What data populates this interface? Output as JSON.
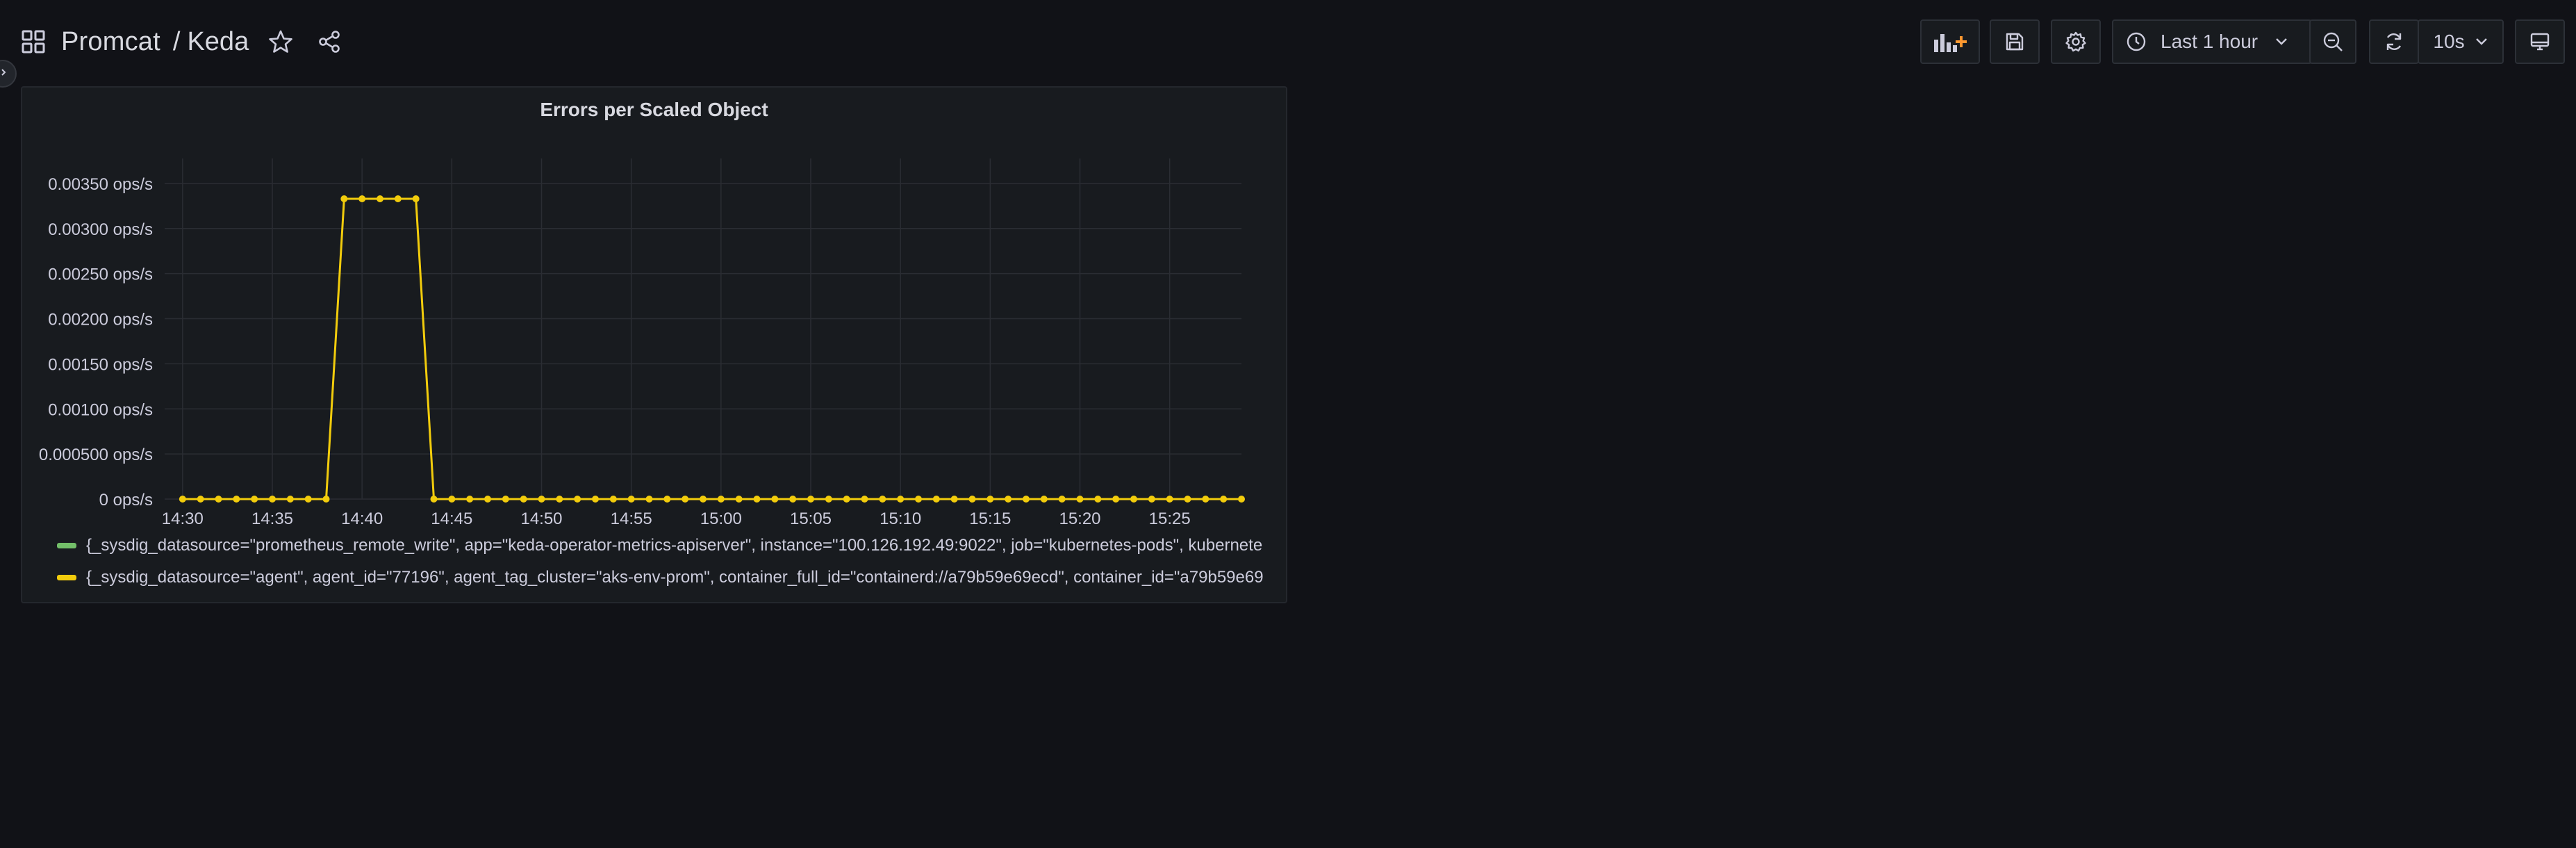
{
  "nav": {
    "parent": "Promcat",
    "separator": "/",
    "current": "Keda"
  },
  "toolbar": {
    "time_range": "Last 1 hour",
    "refresh_interval": "10s",
    "icons": [
      "add-panel-icon",
      "save-icon",
      "gear-icon",
      "clock-icon",
      "zoom-out-icon",
      "refresh-icon",
      "tv-icon"
    ]
  },
  "colors": {
    "background": "#111217",
    "panel": "#181b1f",
    "series_green": "#73bf69",
    "series_yellow": "#f2cc0c",
    "add_panel_accent": "#ff9830"
  },
  "panel": {
    "title": "Errors per Scaled Object"
  },
  "chart_data": {
    "type": "line",
    "title": "Errors per Scaled Object",
    "xlabel": "",
    "ylabel": "",
    "x_tick_labels": [
      "14:30",
      "14:35",
      "14:40",
      "14:45",
      "14:50",
      "14:55",
      "15:00",
      "15:05",
      "15:10",
      "15:15",
      "15:20",
      "15:25"
    ],
    "y_tick_labels": [
      "0 ops/s",
      "0.000500 ops/s",
      "0.00100 ops/s",
      "0.00150 ops/s",
      "0.00200 ops/s",
      "0.00250 ops/s",
      "0.00300 ops/s",
      "0.00350 ops/s"
    ],
    "y_ticks": [
      0,
      0.0005,
      0.001,
      0.0015,
      0.002,
      0.0025,
      0.003,
      0.0035
    ],
    "ylim": [
      0,
      0.0037
    ],
    "x_minutes_range": [
      "14:29",
      "15:29"
    ],
    "grid": true,
    "legend_position": "bottom",
    "series": [
      {
        "name": "{_sysdig_datasource=\"prometheus_remote_write\", app=\"keda-operator-metrics-apiserver\", instance=\"100.126.192.49:9022\", job=\"kubernetes-pods\", kubernete",
        "color": "#73bf69",
        "x": [],
        "values": []
      },
      {
        "name": "{_sysdig_datasource=\"agent\", agent_id=\"77196\", agent_tag_cluster=\"aks-env-prom\", container_full_id=\"containerd://a79b59e69ecd\", container_id=\"a79b59e69",
        "color": "#f2cc0c",
        "x": [
          "14:30",
          "14:31",
          "14:32",
          "14:33",
          "14:34",
          "14:35",
          "14:36",
          "14:37",
          "14:38",
          "14:39",
          "14:40",
          "14:41",
          "14:42",
          "14:43",
          "14:44",
          "14:45",
          "14:46",
          "14:47",
          "14:48",
          "14:49",
          "14:50",
          "14:51",
          "14:52",
          "14:53",
          "14:54",
          "14:55",
          "14:56",
          "14:57",
          "14:58",
          "14:59",
          "15:00",
          "15:01",
          "15:02",
          "15:03",
          "15:04",
          "15:05",
          "15:06",
          "15:07",
          "15:08",
          "15:09",
          "15:10",
          "15:11",
          "15:12",
          "15:13",
          "15:14",
          "15:15",
          "15:16",
          "15:17",
          "15:18",
          "15:19",
          "15:20",
          "15:21",
          "15:22",
          "15:23",
          "15:24",
          "15:25",
          "15:26",
          "15:27",
          "15:28",
          "15:29"
        ],
        "values": [
          0,
          0,
          0,
          0,
          0,
          0,
          0,
          0,
          0,
          0.00333,
          0.00333,
          0.00333,
          0.00333,
          0.00333,
          0,
          0,
          0,
          0,
          0,
          0,
          0,
          0,
          0,
          0,
          0,
          0,
          0,
          0,
          0,
          0,
          0,
          0,
          0,
          0,
          0,
          0,
          0,
          0,
          0,
          0,
          0,
          0,
          0,
          0,
          0,
          0,
          0,
          0,
          0,
          0,
          0,
          0,
          0,
          0,
          0,
          0,
          0,
          0,
          0,
          0
        ]
      }
    ]
  }
}
